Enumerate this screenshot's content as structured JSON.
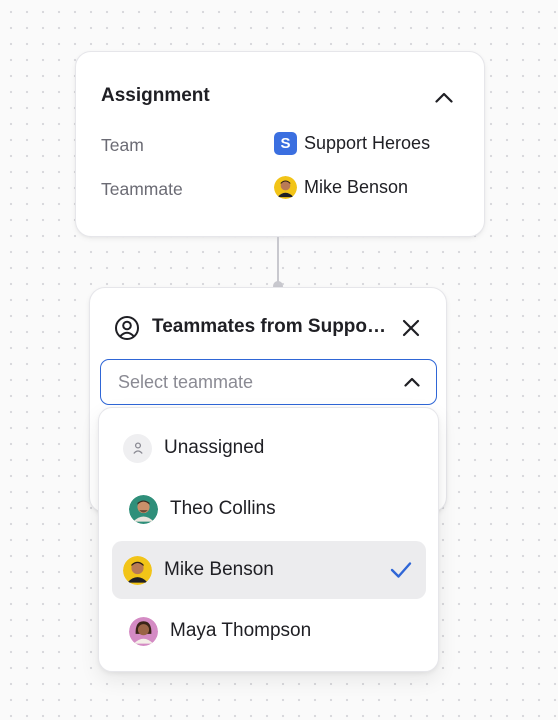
{
  "assignment": {
    "title": "Assignment",
    "rows": [
      {
        "label": "Team",
        "value": "Support Heroes",
        "badge": "S"
      },
      {
        "label": "Teammate",
        "value": "Mike Benson"
      }
    ]
  },
  "panel": {
    "title": "Teammates from Support Heroes",
    "select": {
      "placeholder": "Select teammate",
      "value": ""
    }
  },
  "dropdown": {
    "options": [
      {
        "label": "Unassigned",
        "icon": "user-outline-icon",
        "selected": false
      },
      {
        "label": "Theo Collins",
        "avatar_color": "#2f8f7a",
        "selected": false
      },
      {
        "label": "Mike Benson",
        "avatar_color": "#f2c418",
        "selected": true
      },
      {
        "label": "Maya Thompson",
        "avatar_color": "#d48bc4",
        "selected": false
      }
    ]
  },
  "colors": {
    "accent": "#2f66d6",
    "team_badge": "#3b6fe0",
    "selected_row": "#ececee"
  }
}
